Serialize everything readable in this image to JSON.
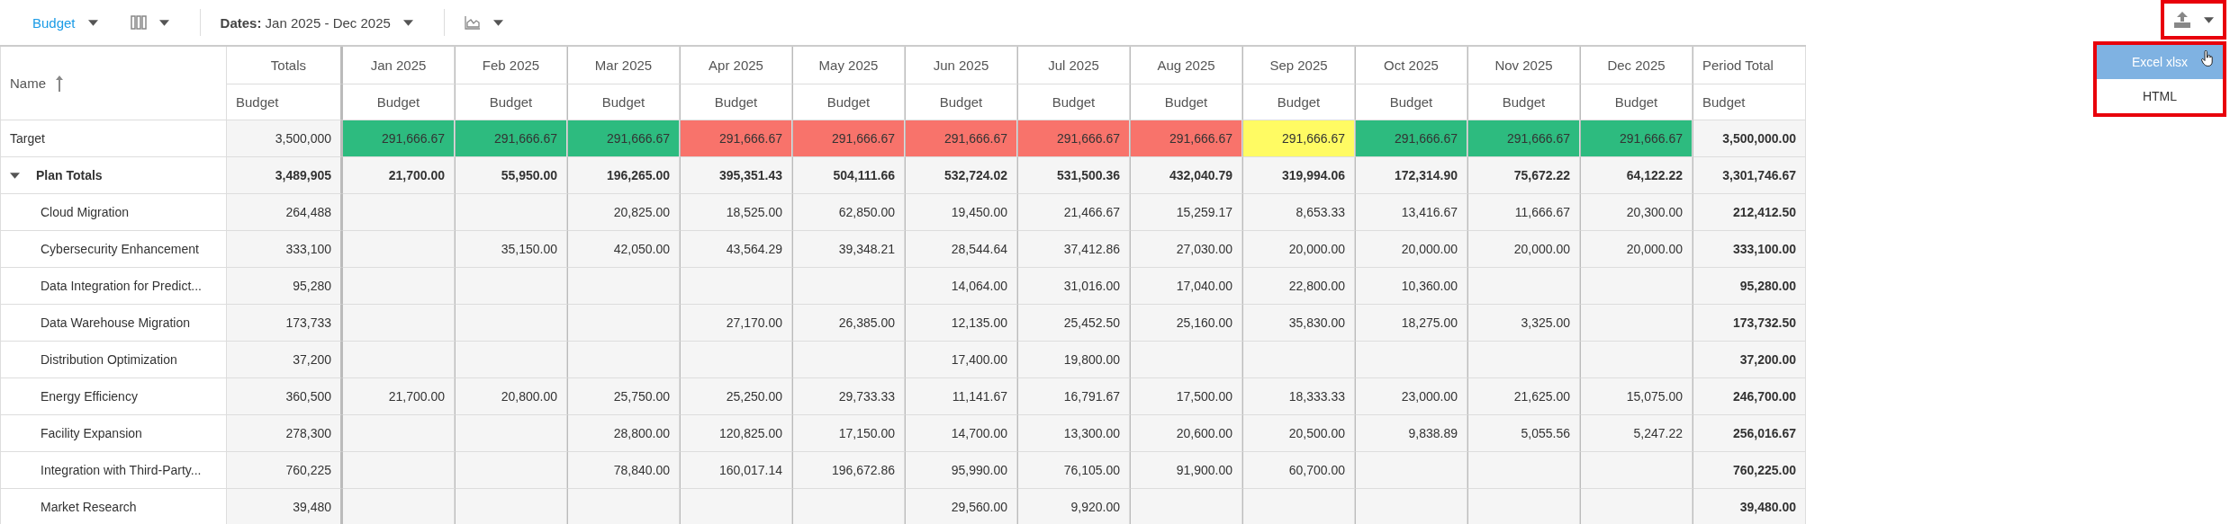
{
  "toolbar": {
    "view": {
      "label": "Budget"
    },
    "dates": "**Dates:** Jan 2025 - Dec 2025"
  },
  "export": {
    "highlighted": true,
    "menu": [
      {
        "label": "Excel xlsx",
        "selected": true
      },
      {
        "label": "HTML",
        "selected": false
      }
    ]
  },
  "table": {
    "name_column": {
      "label": "Name"
    },
    "totals_column": {
      "label": "Totals",
      "sublabel": "Budget"
    },
    "months": [
      {
        "label": "Jan 2025",
        "sublabel": "Budget"
      },
      {
        "label": "Feb 2025",
        "sublabel": "Budget"
      },
      {
        "label": "Mar 2025",
        "sublabel": "Budget"
      },
      {
        "label": "Apr 2025",
        "sublabel": "Budget"
      },
      {
        "label": "May 2025",
        "sublabel": "Budget"
      },
      {
        "label": "Jun 2025",
        "sublabel": "Budget"
      },
      {
        "label": "Jul 2025",
        "sublabel": "Budget"
      },
      {
        "label": "Aug 2025",
        "sublabel": "Budget"
      },
      {
        "label": "Sep 2025",
        "sublabel": "Budget"
      },
      {
        "label": "Oct 2025",
        "sublabel": "Budget"
      },
      {
        "label": "Nov 2025",
        "sublabel": "Budget"
      },
      {
        "label": "Dec 2025",
        "sublabel": "Budget"
      }
    ],
    "period_column": {
      "label": "Period Total",
      "sublabel": "Budget"
    },
    "target": {
      "name": "Target",
      "total": "3,500,000",
      "period_total": "3,500,000.00",
      "cells": [
        {
          "value": "291,666.67",
          "color": "#2dbb7f"
        },
        {
          "value": "291,666.67",
          "color": "#2dbb7f"
        },
        {
          "value": "291,666.67",
          "color": "#2dbb7f"
        },
        {
          "value": "291,666.67",
          "color": "#f8736b"
        },
        {
          "value": "291,666.67",
          "color": "#f8736b"
        },
        {
          "value": "291,666.67",
          "color": "#f8736b"
        },
        {
          "value": "291,666.67",
          "color": "#f8736b"
        },
        {
          "value": "291,666.67",
          "color": "#f8736b"
        },
        {
          "value": "291,666.67",
          "color": "#fffb63"
        },
        {
          "value": "291,666.67",
          "color": "#2dbb7f"
        },
        {
          "value": "291,666.67",
          "color": "#2dbb7f"
        },
        {
          "value": "291,666.67",
          "color": "#2dbb7f"
        }
      ]
    },
    "group": {
      "name": "Plan Totals",
      "expanded": true,
      "total": "3,489,905",
      "period_total": "3,301,746.67",
      "values": [
        "21,700.00",
        "55,950.00",
        "196,265.00",
        "395,351.43",
        "504,111.66",
        "532,724.02",
        "531,500.36",
        "432,040.79",
        "319,994.06",
        "172,314.90",
        "75,672.22",
        "64,122.22"
      ],
      "children": [
        {
          "name": "Cloud Migration",
          "total": "264,488",
          "period_total": "212,412.50",
          "cells": [
            {
              "empty": true
            },
            {
              "empty": true
            },
            {
              "value": "20,825.00"
            },
            {
              "value": "18,525.00"
            },
            {
              "value": "62,850.00"
            },
            {
              "value": "19,450.00"
            },
            {
              "value": "21,466.67"
            },
            {
              "value": "15,259.17"
            },
            {
              "value": "8,653.33"
            },
            {
              "value": "13,416.67"
            },
            {
              "value": "11,666.67"
            },
            {
              "value": "20,300.00"
            }
          ]
        },
        {
          "name": "Cybersecurity Enhancement",
          "total": "333,100",
          "period_total": "333,100.00",
          "cells": [
            {
              "empty": true
            },
            {
              "value": "35,150.00"
            },
            {
              "value": "42,050.00"
            },
            {
              "value": "43,564.29"
            },
            {
              "value": "39,348.21"
            },
            {
              "value": "28,544.64"
            },
            {
              "value": "37,412.86"
            },
            {
              "value": "27,030.00"
            },
            {
              "value": "20,000.00"
            },
            {
              "value": "20,000.00"
            },
            {
              "value": "20,000.00"
            },
            {
              "value": "20,000.00"
            }
          ]
        },
        {
          "name": "Data Integration for Predict...",
          "total": "95,280",
          "period_total": "95,280.00",
          "cells": [
            {
              "empty": true
            },
            {
              "empty": true
            },
            {
              "empty": true
            },
            {
              "empty": true
            },
            {
              "empty": true
            },
            {
              "value": "14,064.00"
            },
            {
              "value": "31,016.00"
            },
            {
              "value": "17,040.00"
            },
            {
              "value": "22,800.00"
            },
            {
              "value": "10,360.00"
            },
            {
              "empty": true
            },
            {
              "empty": true
            }
          ]
        },
        {
          "name": "Data Warehouse Migration",
          "total": "173,733",
          "period_total": "173,732.50",
          "cells": [
            {
              "empty": true
            },
            {
              "empty": true
            },
            {
              "empty": true
            },
            {
              "value": "27,170.00"
            },
            {
              "value": "26,385.00"
            },
            {
              "value": "12,135.00"
            },
            {
              "value": "25,452.50"
            },
            {
              "value": "25,160.00"
            },
            {
              "value": "35,830.00"
            },
            {
              "value": "18,275.00"
            },
            {
              "value": "3,325.00"
            },
            {
              "empty": true
            }
          ]
        },
        {
          "name": "Distribution Optimization",
          "total": "37,200",
          "period_total": "37,200.00",
          "cells": [
            {
              "empty": true
            },
            {
              "empty": true
            },
            {
              "empty": true
            },
            {
              "empty": true
            },
            {
              "empty": true
            },
            {
              "value": "17,400.00"
            },
            {
              "value": "19,800.00"
            },
            {
              "empty": true
            },
            {
              "empty": true
            },
            {
              "empty": true
            },
            {
              "empty": true
            },
            {
              "empty": true
            }
          ]
        },
        {
          "name": "Energy Efficiency",
          "total": "360,500",
          "period_total": "246,700.00",
          "cells": [
            {
              "value": "21,700.00"
            },
            {
              "value": "20,800.00"
            },
            {
              "value": "25,750.00"
            },
            {
              "value": "25,250.00"
            },
            {
              "value": "29,733.33"
            },
            {
              "value": "11,141.67"
            },
            {
              "value": "16,791.67"
            },
            {
              "value": "17,500.00"
            },
            {
              "value": "18,333.33"
            },
            {
              "value": "23,000.00"
            },
            {
              "value": "21,625.00"
            },
            {
              "value": "15,075.00"
            }
          ]
        },
        {
          "name": "Facility Expansion",
          "total": "278,300",
          "period_total": "256,016.67",
          "cells": [
            {
              "empty": true
            },
            {
              "empty": true
            },
            {
              "value": "28,800.00"
            },
            {
              "value": "120,825.00"
            },
            {
              "value": "17,150.00"
            },
            {
              "value": "14,700.00"
            },
            {
              "value": "13,300.00"
            },
            {
              "value": "20,600.00"
            },
            {
              "value": "20,500.00"
            },
            {
              "value": "9,838.89"
            },
            {
              "value": "5,055.56"
            },
            {
              "value": "5,247.22"
            }
          ]
        },
        {
          "name": "Integration with Third-Party...",
          "total": "760,225",
          "period_total": "760,225.00",
          "cells": [
            {
              "empty": true
            },
            {
              "empty": true
            },
            {
              "value": "78,840.00"
            },
            {
              "value": "160,017.14"
            },
            {
              "value": "196,672.86"
            },
            {
              "value": "95,990.00"
            },
            {
              "value": "76,105.00"
            },
            {
              "value": "91,900.00"
            },
            {
              "value": "60,700.00"
            },
            {
              "empty": true
            },
            {
              "empty": true
            },
            {
              "empty": true
            }
          ]
        },
        {
          "name": "Market Research",
          "total": "39,480",
          "period_total": "39,480.00",
          "cells": [
            {
              "empty": true
            },
            {
              "empty": true
            },
            {
              "empty": true
            },
            {
              "empty": true
            },
            {
              "empty": true
            },
            {
              "value": "29,560.00"
            },
            {
              "value": "9,920.00"
            },
            {
              "empty": true
            },
            {
              "empty": true
            },
            {
              "empty": true
            },
            {
              "empty": true
            },
            {
              "empty": true
            }
          ]
        }
      ]
    }
  }
}
